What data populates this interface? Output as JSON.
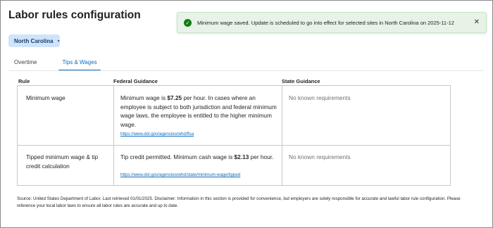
{
  "page": {
    "title": "Labor rules configuration"
  },
  "state_selector": {
    "value": "North Carolina"
  },
  "tabs": [
    {
      "label": "Overtime",
      "active": false
    },
    {
      "label": "Tips & Wages",
      "active": true
    }
  ],
  "toast": {
    "message": "Minimum wage saved. Update is scheduled to go into effect for selected sites in North Carolina on 2025-11-12",
    "status_color": "#107c10"
  },
  "table": {
    "headers": {
      "rule": "Rule",
      "federal": "Federal Guidance",
      "state": "State Guidance"
    },
    "rows": [
      {
        "rule": "Minimum wage",
        "federal_prefix": "Minimum wage is ",
        "federal_amount": "$7.25",
        "federal_suffix": " per hour. In cases where an employee is subject to both jurisdiction and federal minimum wage laws, the employee is entitled to the higher minimum wage.",
        "federal_link": "https://www.dol.gov/agencies/whd/flsa",
        "state": "No known requirements"
      },
      {
        "rule": "Tipped minimum wage & tip credit calculation",
        "federal_prefix": "Tip credit permitted. Minimum cash wage is ",
        "federal_amount": "$2.13",
        "federal_suffix": " per hour.",
        "federal_link": "https://www.dol.gov/agencies/whd/state/minimum-wage/tipped",
        "state": "No known requirements"
      }
    ]
  },
  "footnote": "Source: United States Department of Labor. Last retrieved 01/01/2025. Disclaimer: Information in this section is provided for convenience, but employers are solely responsible for accurate and lawful labor rule configuration. Please reference your local labor laws to ensure all labor rules are accurate and up to date.",
  "colors": {
    "accent": "#0f6cbd",
    "toast_bg": "#e6f3e6",
    "dropdown_bg": "#cfe4fa"
  }
}
